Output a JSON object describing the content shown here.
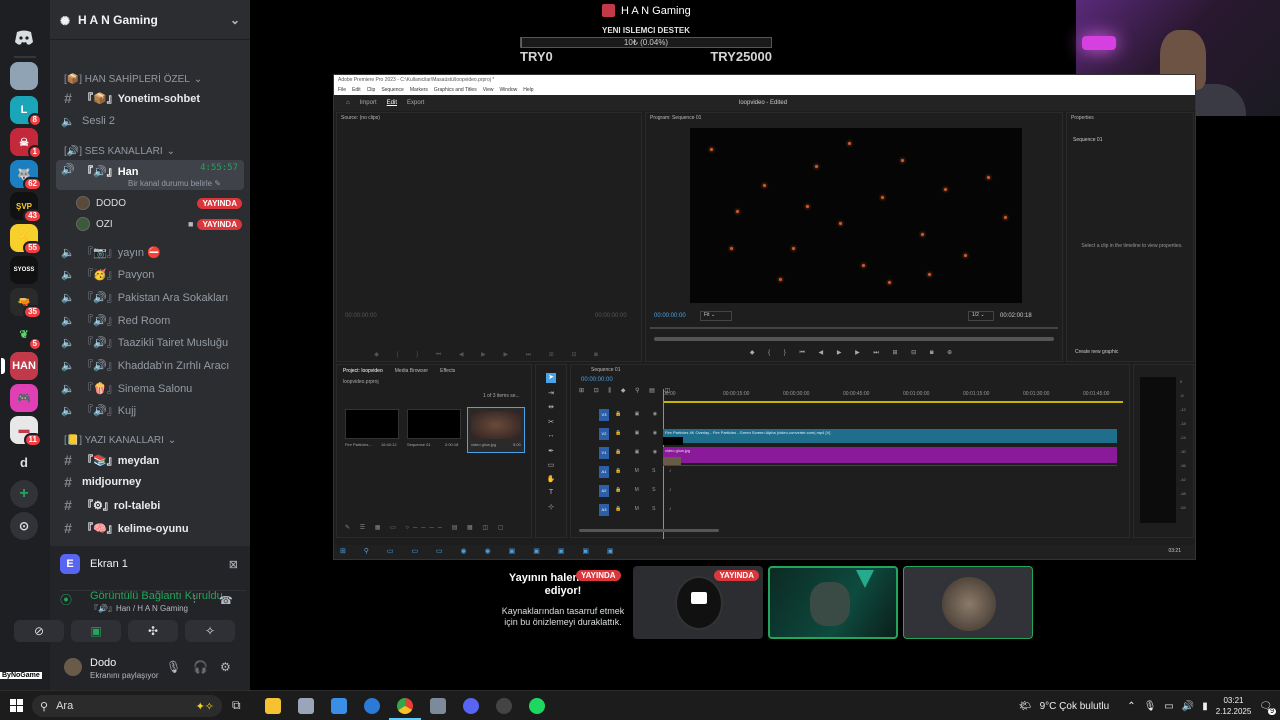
{
  "stream": {
    "title": "H A N Gaming",
    "goal_title": "YENI ISLEMCI DESTEK",
    "goal_progress": "10₺ (0.04%)",
    "goal_fraction": 0.0004,
    "goal_min": "TRY0",
    "goal_max": "TRY25000"
  },
  "server": {
    "name": "H A N Gaming"
  },
  "rail": {
    "badges": [
      "8",
      "1",
      "62",
      "43",
      "55",
      "35",
      "5",
      "11"
    ],
    "letter": "d"
  },
  "channels": {
    "cat_owner": "[📦] HAN SAHİPLERİ ÖZEL",
    "yonetim": "『📦』Yonetim-sohbet",
    "sesli2": "Sesli 2",
    "cat_voice": "[🔊] SES KANALLARI",
    "han": "『🔊』Han",
    "han_status": "Bir kanal durumu belirle",
    "han_time": "4:55:57",
    "users": [
      {
        "name": "DODO",
        "badge": "YAYINDA"
      },
      {
        "name": "OZI",
        "badge": "YAYINDA"
      }
    ],
    "voice_list": [
      "『📷』yayın ⛔",
      "『🥳』Pavyon",
      "『🔊』Pakistan Ara Sokakları",
      "『🔊』Red Room",
      "『🔊』Taazikli Tairet Musluğu",
      "『🔊』Khaddab'ın Zırhlı Aracı",
      "『🍿』Sinema Salonu",
      "『🔊』Kujj"
    ],
    "cat_text": "[📒] YAZI KANALLARI",
    "text_list": [
      "『📚』meydan",
      "midjourney",
      "『⚙』rol-talebi",
      "『🧠』kelime-oyunu"
    ]
  },
  "voice_panel": {
    "screen_label": "Ekran 1",
    "connected": "Görüntülü Bağlantı Kuruldu",
    "channel_path": "『🔊』Han / H A N Gaming",
    "user": "Dodo",
    "user_status": "Ekranını paylaşıyor",
    "badge_corner": "ByNoGame"
  },
  "premiere": {
    "title": "Adobe Premiere Pro 2023 - C:\\Kullanicilar\\Masaüstü\\loopvideo.prproj *",
    "menu": [
      "File",
      "Edit",
      "Clip",
      "Sequence",
      "Markers",
      "Graphics and Titles",
      "View",
      "Window",
      "Help"
    ],
    "nav": [
      "Import",
      "Edit",
      "Export"
    ],
    "project_name": "loopvideo - Edited",
    "source_label": "Source: (no clips)",
    "program_label": "Program: Sequence 01",
    "program_tc": "00:00:00:00",
    "program_fit": "Fit",
    "program_res": "1/2",
    "program_dur": "00:02:00:18",
    "source_tc": "00:00:00:00",
    "source_tc2": "00:00:00:00",
    "properties_label": "Properties",
    "properties_seq": "Sequence 01",
    "properties_hint": "Select a clip in the timeline to view properties.",
    "create_graphic": "Create new graphic",
    "project_tabs": [
      "Project: loopvideo",
      "Media Browser",
      "Effects"
    ],
    "project_file": "loopvideo.prproj",
    "project_count": "1 of 3 items se...",
    "bins": [
      {
        "name": "Fire Particles...",
        "dur": "16:40:12"
      },
      {
        "name": "Sequence 01",
        "dur": "2:00:18"
      },
      {
        "name": "video glow.jpg",
        "dur": "5:00"
      }
    ],
    "seq_tab": "Sequence 01",
    "seq_tc": "00:00:00:00",
    "ruler": [
      "00:00",
      "00:00:15:00",
      "00:00:30:00",
      "00:00:45:00",
      "00:01:00:00",
      "00:01:15:00",
      "00:01:30:00",
      "00:01:45:00"
    ],
    "clip_v2": "Fire Particles 4K Overlay - Fire Particles - Green Screen Alpha (video-converter.com).mp4 [V]",
    "clip_v1": "video glow.jpg",
    "tracks": [
      "V3",
      "V2",
      "V1",
      "A1",
      "A2",
      "A3"
    ],
    "meter": [
      "0",
      "-6",
      "-12",
      "-18",
      "-24",
      "-30",
      "-36",
      "-42",
      "-48",
      "-54"
    ],
    "taskbar_time": "03:21"
  },
  "paused": {
    "badge": "YAYINDA",
    "heading": "Yayının halen devam ediyor!",
    "sub": "Kaynaklarından tasarruf etmek için bu önizlemeyi duraklattık.",
    "thumb_badge": "YAYINDA"
  },
  "taskbar": {
    "search": "Ara",
    "weather": "9°C  Çok bulutlu",
    "time": "03:21",
    "date": "2.12.2025",
    "notif": "9"
  },
  "colors": {
    "accent_live": "#da373c",
    "voice_green": "#23a55a",
    "blurple": "#5865f2",
    "premiere_blue": "#4aa3e6",
    "clip_teal": "#1e6e8c",
    "clip_magenta": "#8a1a9a"
  }
}
